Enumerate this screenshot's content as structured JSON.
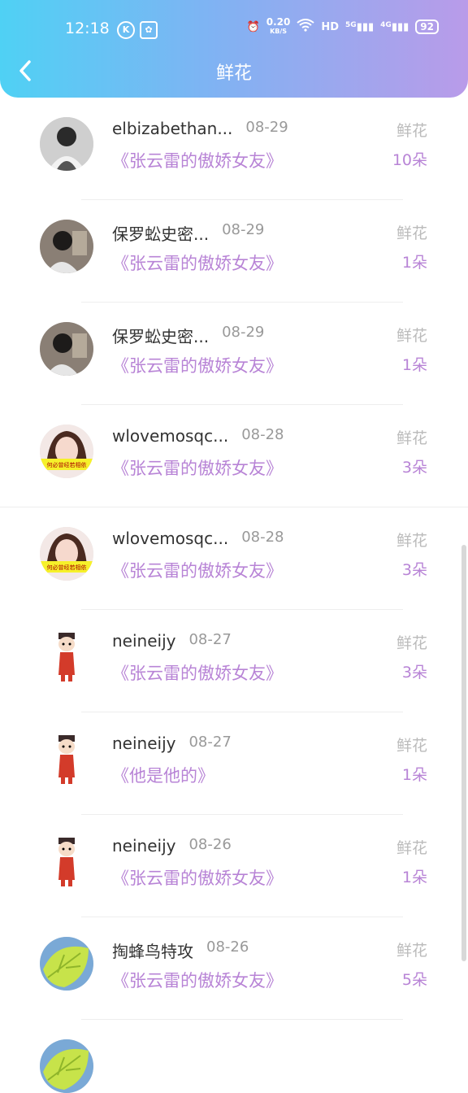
{
  "status_bar": {
    "time": "12:18",
    "speed_value": "0.20",
    "speed_unit": "KB/S",
    "hd": "HD",
    "net5g": "5G",
    "net4g": "4G",
    "battery": "92"
  },
  "header": {
    "title": "鲜花"
  },
  "items": [
    {
      "name": "elbizabethan...",
      "date": "08-29",
      "book": "《张云雷的傲娇女友》",
      "kind": "鲜花",
      "count": "10朵",
      "avatar": "bw-photo"
    },
    {
      "name": "保罗蚣史密...",
      "date": "08-29",
      "book": "《张云雷的傲娇女友》",
      "kind": "鲜花",
      "count": "1朵",
      "avatar": "dark-photo"
    },
    {
      "name": "保罗蚣史密...",
      "date": "08-29",
      "book": "《张云雷的傲娇女友》",
      "kind": "鲜花",
      "count": "1朵",
      "avatar": "dark-photo"
    },
    {
      "name": "wlovemosqc...",
      "date": "08-28",
      "book": "《张云雷的傲娇女友》",
      "kind": "鲜花",
      "count": "3朵",
      "avatar": "girl-photo"
    },
    {
      "name": "wlovemosqc...",
      "date": "08-28",
      "book": "《张云雷的傲娇女友》",
      "kind": "鲜花",
      "count": "3朵",
      "avatar": "girl-photo"
    },
    {
      "name": "neineijy",
      "date": "08-27",
      "book": "《张云雷的傲娇女友》",
      "kind": "鲜花",
      "count": "3朵",
      "avatar": "cartoon"
    },
    {
      "name": "neineijy",
      "date": "08-27",
      "book": "《他是他的》",
      "kind": "鲜花",
      "count": "1朵",
      "avatar": "cartoon"
    },
    {
      "name": "neineijy",
      "date": "08-26",
      "book": "《张云雷的傲娇女友》",
      "kind": "鲜花",
      "count": "1朵",
      "avatar": "cartoon"
    },
    {
      "name": "掏蜂鸟特攻",
      "date": "08-26",
      "book": "《张云雷的傲娇女友》",
      "kind": "鲜花",
      "count": "5朵",
      "avatar": "leaf"
    }
  ],
  "colors": {
    "accent": "#b884d6",
    "gradient_start": "#4fd1f4",
    "gradient_end": "#b99be9"
  }
}
